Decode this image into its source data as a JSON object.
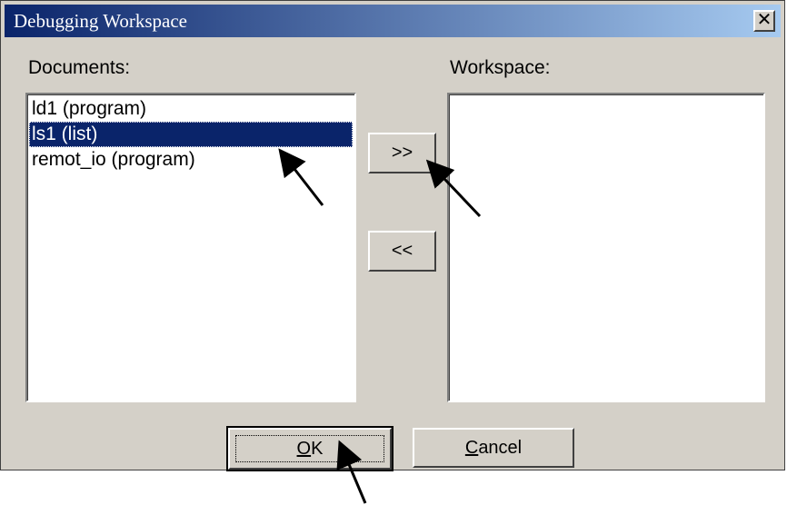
{
  "window": {
    "title": "Debugging Workspace",
    "close_glyph": "✕"
  },
  "documents": {
    "label": "Documents:",
    "items": [
      {
        "label": "ld1 (program)",
        "selected": false
      },
      {
        "label": "ls1 (list)",
        "selected": true
      },
      {
        "label": "remot_io (program)",
        "selected": false
      }
    ]
  },
  "workspace": {
    "label": "Workspace:",
    "items": []
  },
  "buttons": {
    "add": ">>",
    "remove": "<<",
    "ok_mnemonic": "O",
    "ok_rest": "K",
    "cancel_mnemonic": "C",
    "cancel_rest": "ancel"
  },
  "colors": {
    "selection": "#0a246a",
    "face": "#d4d0c8"
  }
}
